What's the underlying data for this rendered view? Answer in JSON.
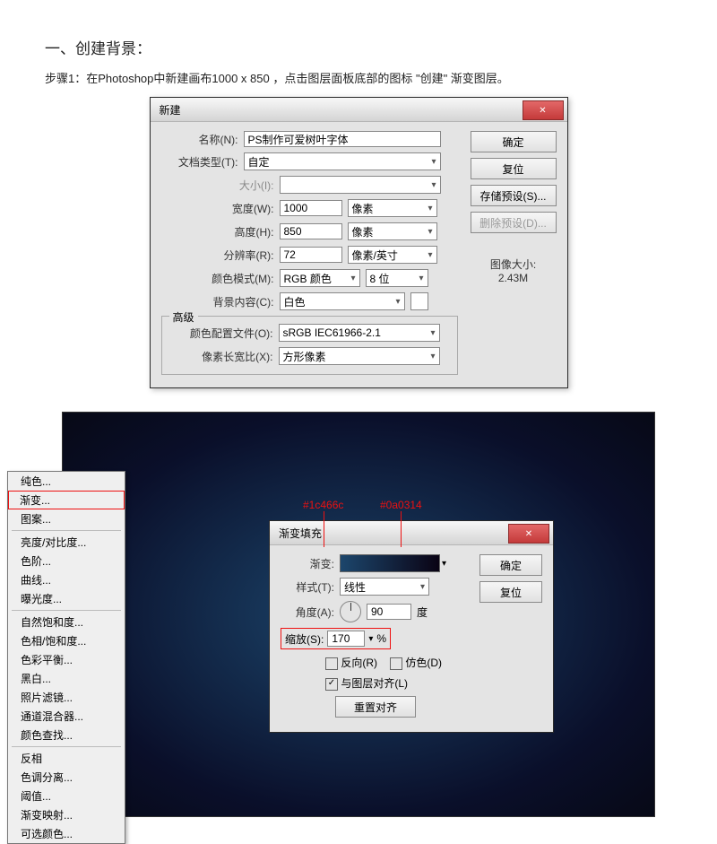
{
  "heading": "一、创建背景：",
  "subtext": "步骤1：在Photoshop中新建画布1000 x 850 ，点击图层面板底部的图标 \"创建\" 渐变图层。",
  "newDialog": {
    "title": "新建",
    "nameLabel": "名称(N):",
    "nameValue": "PS制作可爱树叶字体",
    "presetLabel": "文档类型(T):",
    "presetValue": "自定",
    "sizeLabel": "大小(I):",
    "widthLabel": "宽度(W):",
    "widthValue": "1000",
    "widthUnit": "像素",
    "heightLabel": "高度(H):",
    "heightValue": "850",
    "heightUnit": "像素",
    "resLabel": "分辨率(R):",
    "resValue": "72",
    "resUnit": "像素/英寸",
    "modeLabel": "颜色模式(M):",
    "modeValue": "RGB 颜色",
    "bitDepth": "8 位",
    "bgLabel": "背景内容(C):",
    "bgValue": "白色",
    "advanced": "高级",
    "profileLabel": "颜色配置文件(O):",
    "profileValue": "sRGB IEC61966-2.1",
    "aspectLabel": "像素长宽比(X):",
    "aspectValue": "方形像素",
    "ok": "确定",
    "reset": "复位",
    "savePreset": "存储预设(S)...",
    "deletePreset": "删除预设(D)...",
    "imageSizeLabel": "图像大小:",
    "imageSizeValue": "2.43M"
  },
  "menuItems": {
    "group1": [
      "纯色...",
      "渐变...",
      "图案..."
    ],
    "highlighted": "渐变...",
    "group2": [
      "亮度/对比度...",
      "色阶...",
      "曲线...",
      "曝光度..."
    ],
    "group3": [
      "自然饱和度...",
      "色相/饱和度...",
      "色彩平衡...",
      "黑白...",
      "照片滤镜...",
      "通道混合器...",
      "颜色查找..."
    ],
    "group4": [
      "反相",
      "色调分离...",
      "阈值...",
      "渐变映射...",
      "可选颜色..."
    ]
  },
  "annotations": {
    "color1": "#1c466c",
    "color2": "#0a0314"
  },
  "gradientDialog": {
    "title": "渐变填充",
    "gradientLabel": "渐变:",
    "styleLabel": "样式(T):",
    "styleValue": "线性",
    "angleLabel": "角度(A):",
    "angleValue": "90",
    "angleUnit": "度",
    "scaleLabel": "缩放(S):",
    "scaleValue": "170",
    "scaleUnit": "%",
    "reverseLabel": "反向(R)",
    "ditherLabel": "仿色(D)",
    "alignLabel": "与图层对齐(L)",
    "resetAlign": "重置对齐",
    "ok": "确定",
    "reset": "复位"
  }
}
